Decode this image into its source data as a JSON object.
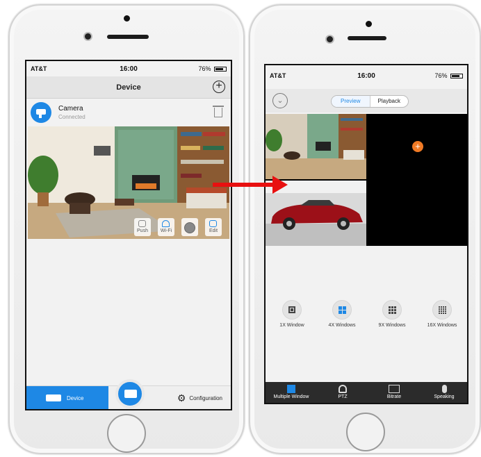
{
  "left_phone": {
    "status": {
      "carrier": "AT&T",
      "time": "16:00",
      "battery": "76%"
    },
    "nav": {
      "title": "Device"
    },
    "device": {
      "name": "Camera",
      "status": "Connected"
    },
    "preview_actions": [
      "Push",
      "Wi-Fi",
      "",
      "Edit"
    ],
    "tabbar": {
      "device_label": "Device",
      "config_label": "Configuration"
    }
  },
  "right_phone": {
    "status": {
      "carrier": "AT&T",
      "time": "16:00",
      "battery": "76%"
    },
    "segment": {
      "preview": "Preview",
      "playback": "Playback"
    },
    "modes": [
      "1X Window",
      "4X Windows",
      "9X Windows",
      "16X Windows"
    ],
    "bottom_bar": [
      "Multiple Window",
      "PTZ",
      "Bitrate",
      "Speaking"
    ]
  },
  "colors": {
    "accent": "#1e88e5",
    "arrow": "#e81010",
    "add_button": "#f07a25"
  }
}
